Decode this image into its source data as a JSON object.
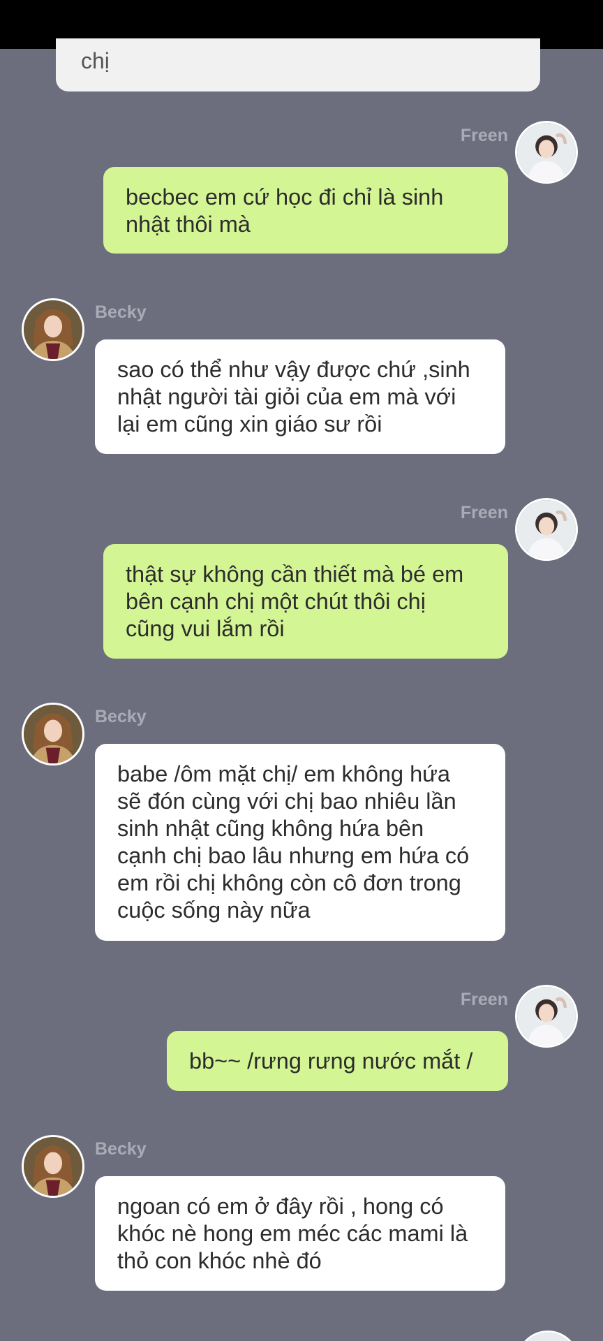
{
  "top_card": {
    "text": "chị"
  },
  "messages": [
    {
      "sender": "Freen",
      "side": "right",
      "text": "becbec em cứ học đi chỉ là sinh\nnhật thôi mà"
    },
    {
      "sender": "Becky",
      "side": "left",
      "text": "sao có thể như vậy được chứ ,sinh\nnhật người tài giỏi của em mà với\nlại em cũng xin giáo sư rồi"
    },
    {
      "sender": "Freen",
      "side": "right",
      "text": "thật sự không cần thiết mà bé em\nbên cạnh chị một chút thôi chị\ncũng vui lắm rồi"
    },
    {
      "sender": "Becky",
      "side": "left",
      "text": "babe /ôm mặt chị/ em không hứa\nsẽ đón cùng với chị bao nhiêu lần\nsinh nhật cũng không hứa bên\ncạnh chị bao lâu nhưng em hứa có\nem rồi chị không còn cô đơn trong\ncuộc sống này nữa"
    },
    {
      "sender": "Freen",
      "side": "right",
      "text": "bb~~ /rưng rưng nước mắt /"
    },
    {
      "sender": "Becky",
      "side": "left",
      "text": "ngoan có em ở đây rồi , hong có\nkhóc nè hong em méc các mami là\nthỏ con khóc nhè đó"
    }
  ],
  "colors": {
    "background": "#6c6e7e",
    "freen_bubble": "#d4f594",
    "becky_bubble": "#ffffff",
    "name_text": "#a9abb6"
  }
}
